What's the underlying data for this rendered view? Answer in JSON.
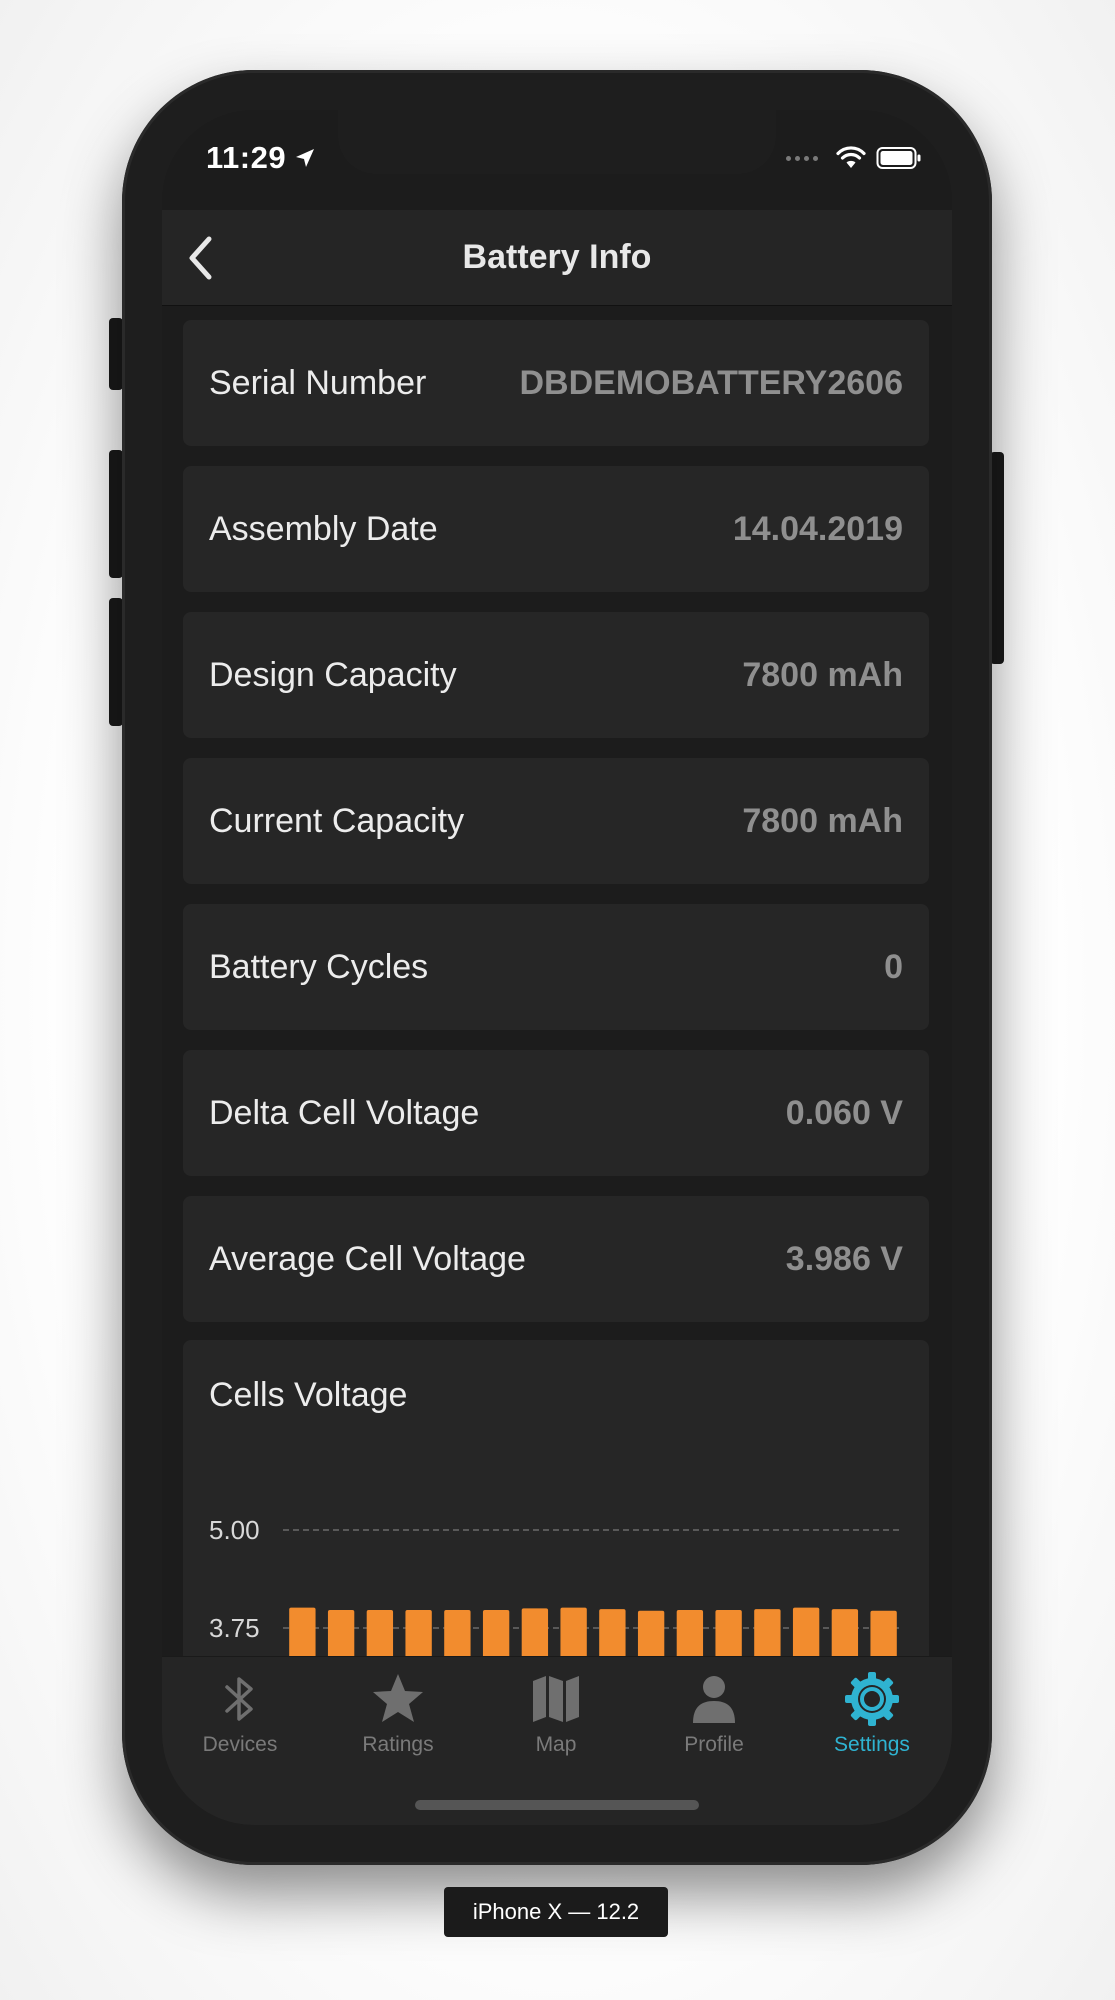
{
  "status_bar": {
    "time": "11:29",
    "location_icon": "location-arrow-icon",
    "wifi_icon": "wifi-icon",
    "battery_icon": "battery-icon"
  },
  "nav": {
    "title": "Battery Info",
    "back_icon": "chevron-left-icon"
  },
  "rows": [
    {
      "label": "Serial Number",
      "value": "DBDEMOBATTERY2606"
    },
    {
      "label": "Assembly Date",
      "value": "14.04.2019"
    },
    {
      "label": "Design Capacity",
      "value": "7800 mAh"
    },
    {
      "label": "Current Capacity",
      "value": "7800 mAh"
    },
    {
      "label": "Battery Cycles",
      "value": "0"
    },
    {
      "label": "Delta Cell Voltage",
      "value": "0.060 V"
    },
    {
      "label": "Average Cell Voltage",
      "value": "3.986 V"
    }
  ],
  "cells_card": {
    "title": "Cells Voltage"
  },
  "chart_data": {
    "type": "bar",
    "title": "Cells Voltage",
    "xlabel": "",
    "ylabel": "",
    "y_ticks": [
      "5.00",
      "3.75"
    ],
    "ylim": [
      3.75,
      5.0
    ],
    "grid": true,
    "bar_color": "#f28c2e",
    "values": [
      4.01,
      3.98,
      3.98,
      3.98,
      3.98,
      3.98,
      4.0,
      4.01,
      3.99,
      3.97,
      3.98,
      3.98,
      3.99,
      4.01,
      3.99,
      3.97
    ]
  },
  "tabs": [
    {
      "label": "Devices",
      "icon": "bluetooth-icon",
      "active": false
    },
    {
      "label": "Ratings",
      "icon": "star-icon",
      "active": false
    },
    {
      "label": "Map",
      "icon": "map-icon",
      "active": false
    },
    {
      "label": "Profile",
      "icon": "person-icon",
      "active": false
    },
    {
      "label": "Settings",
      "icon": "gear-icon",
      "active": true
    }
  ],
  "colors": {
    "accent": "#2fb3d1",
    "bar": "#f28c2e",
    "background": "#1c1c1c",
    "card": "#262626"
  },
  "device_label": "iPhone X — 12.2"
}
